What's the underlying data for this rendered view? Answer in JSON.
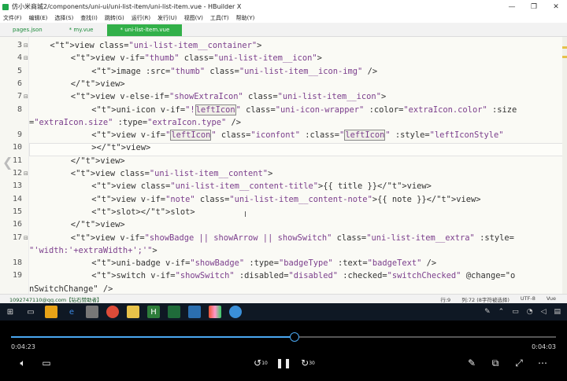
{
  "window": {
    "title": "仿小米商城2/components/uni-ui/uni-list-item/uni-list-item.vue - HBuilder X",
    "controls": [
      "—",
      "❐",
      "✕"
    ]
  },
  "menu": [
    "文件(F)",
    "编辑(E)",
    "选择(S)",
    "查找(I)",
    "跳转(G)",
    "运行(R)",
    "发行(U)",
    "视图(V)",
    "工具(T)",
    "帮助(Y)"
  ],
  "tabs": [
    "pages.json",
    "* my.vue",
    "* uni-list-item.vue"
  ],
  "active_tab_index": 2,
  "editor": {
    "line_numbers": [
      "3",
      "4",
      "5",
      "6",
      "7",
      "8",
      "",
      "9",
      "10",
      "11",
      "12",
      "13",
      "14",
      "15",
      "16",
      "17",
      "",
      "18",
      "19",
      ""
    ],
    "fold_markers": [
      "⊟",
      "⊟",
      "",
      "",
      "⊟",
      "",
      "",
      "",
      "",
      "",
      "⊟",
      "",
      "",
      "",
      "",
      "⊟",
      "",
      "",
      "",
      ""
    ],
    "code": [
      "<view class=\"uni-list-item__container\">",
      "<view v-if=\"thumb\" class=\"uni-list-item__icon\">",
      "<image :src=\"thumb\" class=\"uni-list-item__icon-img\" />",
      "</view>",
      "<view v-else-if=\"showExtraIcon\" class=\"uni-list-item__icon\">",
      "<uni-icon v-if=\"!leftIcon\" class=\"uni-icon-wrapper\" :color=\"extraIcon.color\" :size",
      "=\"extraIcon.size\" :type=\"extraIcon.type\" />",
      "<view v-if=\"leftIcon\" class=\"iconfont\" :class=\"leftIcon\" :style=\"leftIconStyle\"",
      "></view>",
      "</view>",
      "<view class=\"uni-list-item__content\">",
      "<view class=\"uni-list-item__content-title\">{{ title }}</view>",
      "<view v-if=\"note\" class=\"uni-list-item__content-note\">{{ note }}</view>",
      "<slot></slot>",
      "</view>",
      "<view v-if=\"showBadge || showArrow || showSwitch\" class=\"uni-list-item__extra\" :style=",
      "\"'width:'+extraWidth+';'\">",
      "<uni-badge v-if=\"showBadge\" :type=\"badgeType\" :text=\"badgeText\" />",
      "<switch v-if=\"showSwitch\" :disabled=\"disabled\" :checked=\"switchChecked\" @change=\"o",
      "nSwitchChange\" />"
    ]
  },
  "status": {
    "left": "1092747110@qq.com【钻石赞助者】",
    "line": "行:9",
    "col": "列:72 (8字符被选择)",
    "encoding": "UTF-8",
    "lang": "Vue"
  },
  "player": {
    "current_time": "0:04:23",
    "total_time": "0:04:03",
    "progress": 0.52,
    "rewind_label": "10",
    "forward_label": "30"
  }
}
